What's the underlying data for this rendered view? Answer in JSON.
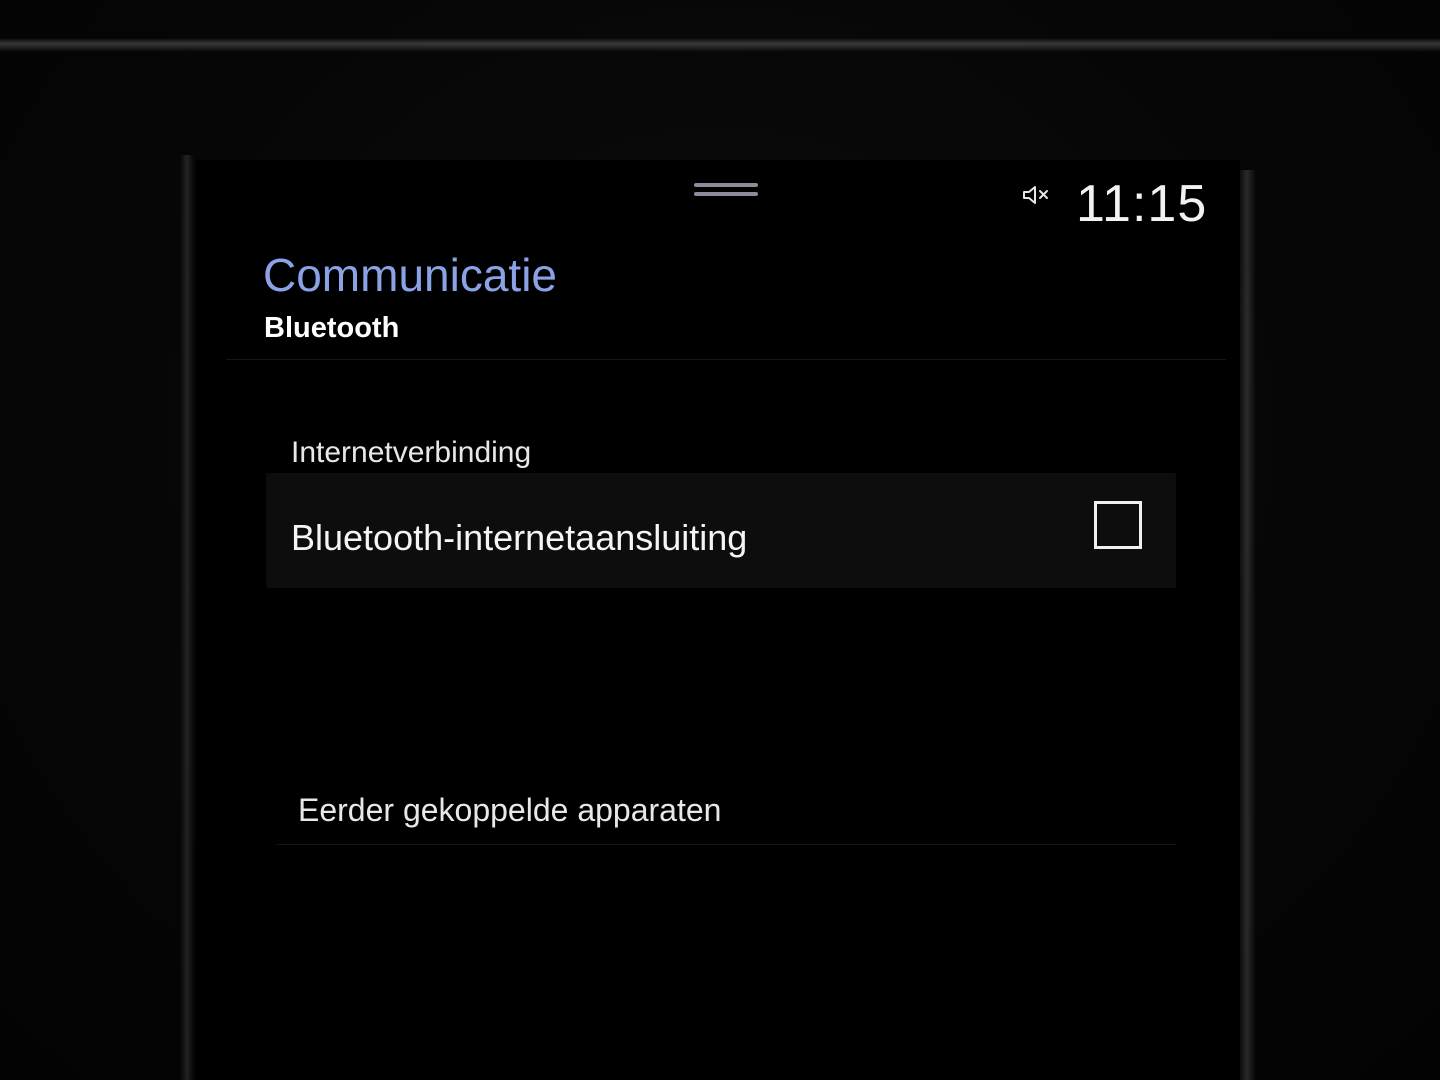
{
  "status_bar": {
    "time": "11:15",
    "mute_icon": "speaker-muted-icon",
    "drag_handle_icon": "drag-handle-icon"
  },
  "header": {
    "title": "Communicatie",
    "subtitle": "Bluetooth"
  },
  "sections": [
    {
      "label": "Internetverbinding",
      "items": [
        {
          "label": "Bluetooth-internetaansluiting",
          "checked": false
        }
      ]
    },
    {
      "label": "Eerder gekoppelde apparaten"
    }
  ],
  "colors": {
    "title_accent": "#8aa3e6",
    "background": "#000000",
    "row_background": "#0d0d0e",
    "text": "#f5f5f5"
  }
}
